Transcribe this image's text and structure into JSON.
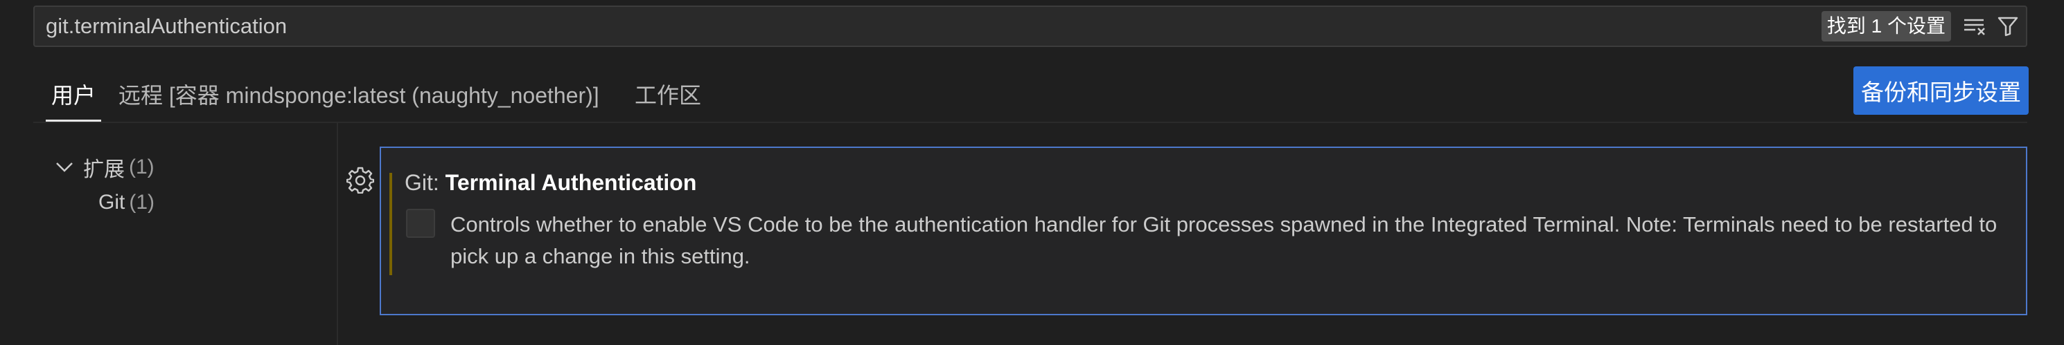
{
  "search": {
    "value": "git.terminalAuthentication",
    "result_badge": "找到 1 个设置",
    "clear_filter_icon": "clear-filter-icon",
    "filter_icon": "filter-icon"
  },
  "tabs": [
    {
      "label": "用户",
      "active": true
    },
    {
      "label": "远程 [容器 mindsponge:latest (naughty_noether)]",
      "active": false
    },
    {
      "label": "工作区",
      "active": false
    }
  ],
  "sync_button": {
    "label": "备份和同步设置"
  },
  "toc": {
    "items": [
      {
        "label": "扩展",
        "count": "(1)",
        "icon": "chevron-down-icon"
      },
      {
        "label": "Git",
        "count": "(1)"
      }
    ]
  },
  "setting": {
    "gear_icon": "gear-icon",
    "category": "Git: ",
    "name": "Terminal Authentication",
    "description": "Controls whether to enable VS Code to be the authentication handler for Git processes spawned in the Integrated Terminal. Note: Terminals need to be restarted to pick up a change in this setting.",
    "checked": false
  },
  "colors": {
    "background": "#1f1f1f",
    "accent": "#2b6fd6",
    "focus_border": "#4d78cc",
    "modified_indicator": "#7a6400"
  }
}
